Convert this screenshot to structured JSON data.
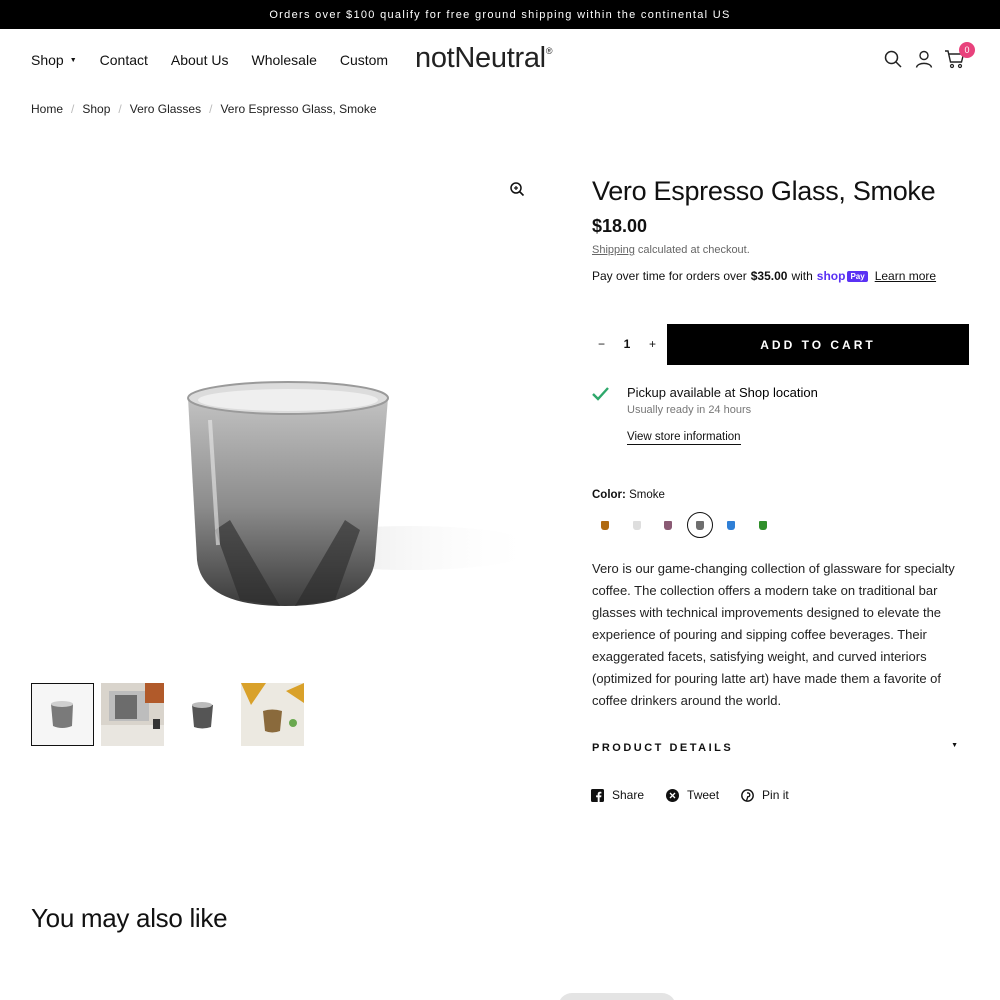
{
  "announcement": "Orders over $100 qualify for free ground shipping within the continental US",
  "nav": [
    {
      "label": "Shop",
      "has_dropdown": true
    },
    {
      "label": "Contact"
    },
    {
      "label": "About Us"
    },
    {
      "label": "Wholesale"
    },
    {
      "label": "Custom"
    }
  ],
  "logo": {
    "text": "notNeutral",
    "mark": "®"
  },
  "header_icons": [
    "search-icon",
    "account-icon",
    "cart-icon"
  ],
  "cart_count": "0",
  "breadcrumbs": [
    "Home",
    "Shop",
    "Vero Glasses",
    "Vero Espresso Glass, Smoke"
  ],
  "product": {
    "title": "Vero Espresso Glass, Smoke",
    "price": "$18.00",
    "shipping_link": "Shipping",
    "shipping_text": " calculated at checkout.",
    "payover_text": "Pay over time for orders over",
    "payover_amount": "$35.00",
    "payover_with": "with",
    "shoppay_brand": "shop",
    "shoppay_badge": "Pay",
    "learn_more": "Learn more",
    "quantity": "1",
    "qty_minus": "−",
    "qty_plus": "+",
    "add_to_cart": "ADD TO CART",
    "pickup_prefix": "Pickup available at ",
    "pickup_location": "Shop location",
    "pickup_ready": "Usually ready in 24 hours",
    "store_info": "View store information",
    "color_label": "Color:",
    "color_value": "Smoke",
    "swatches": [
      {
        "name": "Amber",
        "color": "#b06a10"
      },
      {
        "name": "Clear",
        "color": "#dedede"
      },
      {
        "name": "Pink",
        "color": "#8a5a74"
      },
      {
        "name": "Smoke",
        "color": "#6e6e6e",
        "selected": true
      },
      {
        "name": "Blue",
        "color": "#2f7fd6"
      },
      {
        "name": "Green",
        "color": "#2f8f2a"
      }
    ],
    "description": "Vero is our game-changing collection of glassware for specialty coffee. The collection offers a modern take on traditional bar glasses with technical improvements designed to elevate the experience of pouring and sipping coffee beverages. Their exaggerated facets, satisfying weight, and curved interiors (optimized for pouring latte art) have made them a favorite of coffee drinkers around the world.",
    "details_label": "PRODUCT DETAILS"
  },
  "social": [
    {
      "label": "Share",
      "icon": "facebook-icon"
    },
    {
      "label": "Tweet",
      "icon": "x-icon"
    },
    {
      "label": "Pin it",
      "icon": "pinterest-icon"
    }
  ],
  "related_title": "You may also like",
  "colors": {
    "accent": "#000000",
    "badge": "#e8427c",
    "shoppay": "#5a31f4",
    "check": "#2ea86b"
  }
}
